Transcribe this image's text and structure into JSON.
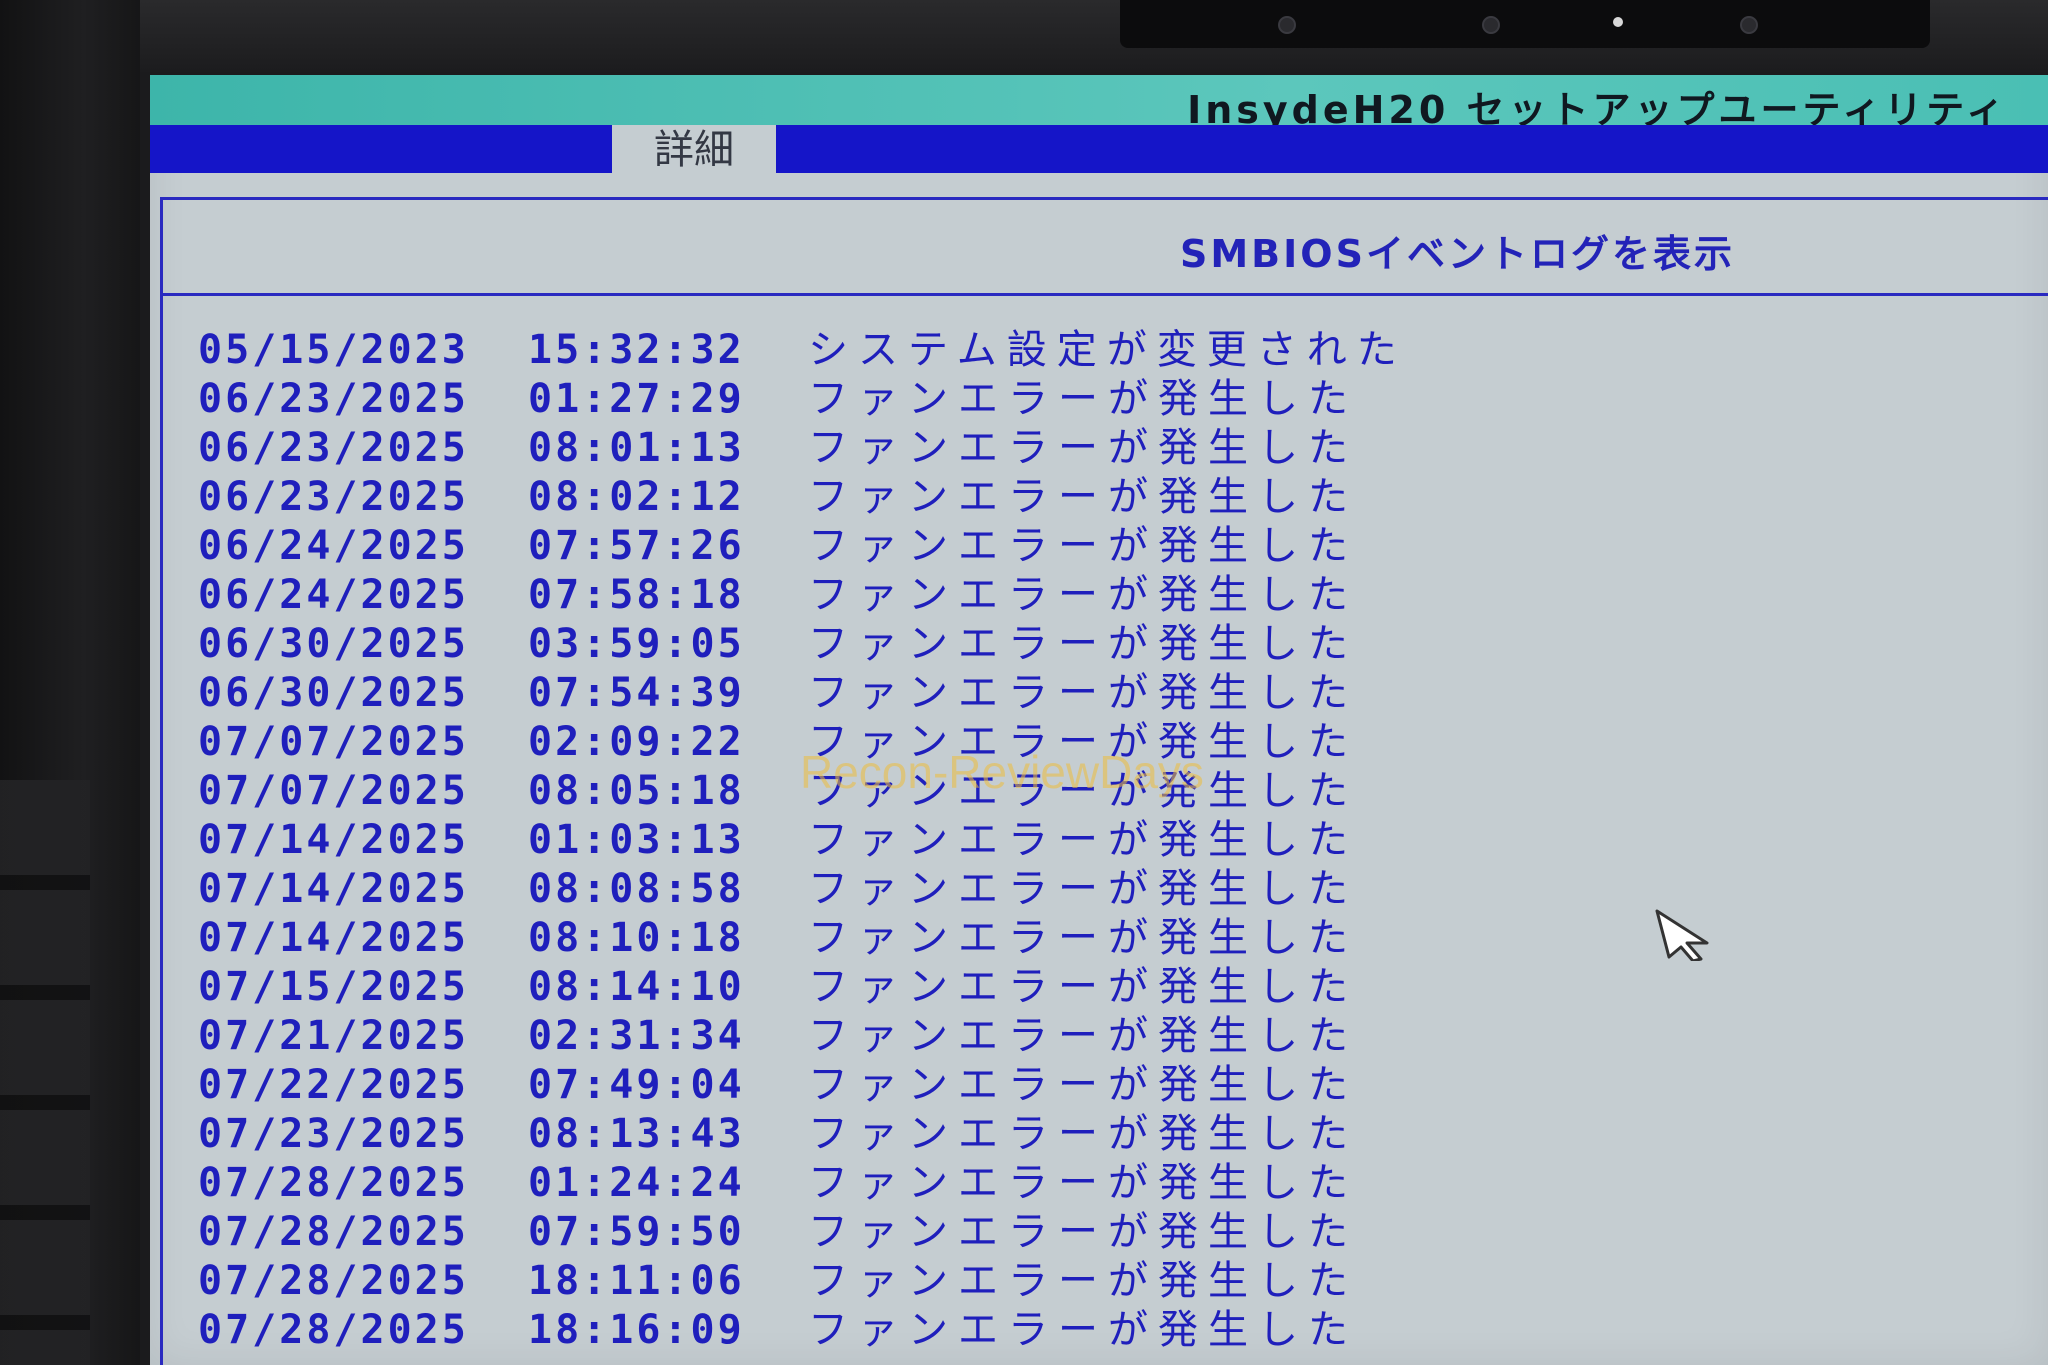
{
  "window": {
    "title": "InsydeH20 セットアップユーティリティ",
    "active_tab": "詳細"
  },
  "page": {
    "heading": "SMBIOSイベントログを表示"
  },
  "log_entries": [
    {
      "date": "05/15/2023",
      "time": "15:32:32",
      "message": "システム設定が変更された"
    },
    {
      "date": "06/23/2025",
      "time": "01:27:29",
      "message": "ファンエラーが発生した"
    },
    {
      "date": "06/23/2025",
      "time": "08:01:13",
      "message": "ファンエラーが発生した"
    },
    {
      "date": "06/23/2025",
      "time": "08:02:12",
      "message": "ファンエラーが発生した"
    },
    {
      "date": "06/24/2025",
      "time": "07:57:26",
      "message": "ファンエラーが発生した"
    },
    {
      "date": "06/24/2025",
      "time": "07:58:18",
      "message": "ファンエラーが発生した"
    },
    {
      "date": "06/30/2025",
      "time": "03:59:05",
      "message": "ファンエラーが発生した"
    },
    {
      "date": "06/30/2025",
      "time": "07:54:39",
      "message": "ファンエラーが発生した"
    },
    {
      "date": "07/07/2025",
      "time": "02:09:22",
      "message": "ファンエラーが発生した"
    },
    {
      "date": "07/07/2025",
      "time": "08:05:18",
      "message": "ファンエラーが発生した"
    },
    {
      "date": "07/14/2025",
      "time": "01:03:13",
      "message": "ファンエラーが発生した"
    },
    {
      "date": "07/14/2025",
      "time": "08:08:58",
      "message": "ファンエラーが発生した"
    },
    {
      "date": "07/14/2025",
      "time": "08:10:18",
      "message": "ファンエラーが発生した"
    },
    {
      "date": "07/15/2025",
      "time": "08:14:10",
      "message": "ファンエラーが発生した"
    },
    {
      "date": "07/21/2025",
      "time": "02:31:34",
      "message": "ファンエラーが発生した"
    },
    {
      "date": "07/22/2025",
      "time": "07:49:04",
      "message": "ファンエラーが発生した"
    },
    {
      "date": "07/23/2025",
      "time": "08:13:43",
      "message": "ファンエラーが発生した"
    },
    {
      "date": "07/28/2025",
      "time": "01:24:24",
      "message": "ファンエラーが発生した"
    },
    {
      "date": "07/28/2025",
      "time": "07:59:50",
      "message": "ファンエラーが発生した"
    },
    {
      "date": "07/28/2025",
      "time": "18:11:06",
      "message": "ファンエラーが発生した"
    },
    {
      "date": "07/28/2025",
      "time": "18:16:09",
      "message": "ファンエラーが発生した"
    }
  ],
  "watermark": "Recon-ReviewDays",
  "icons": {
    "cursor": "mouse-pointer-icon"
  },
  "colors": {
    "title_bar": "#4abfb4",
    "menu_bar": "#1515c8",
    "background": "#c5cdd1",
    "text": "#1f1fbc"
  }
}
